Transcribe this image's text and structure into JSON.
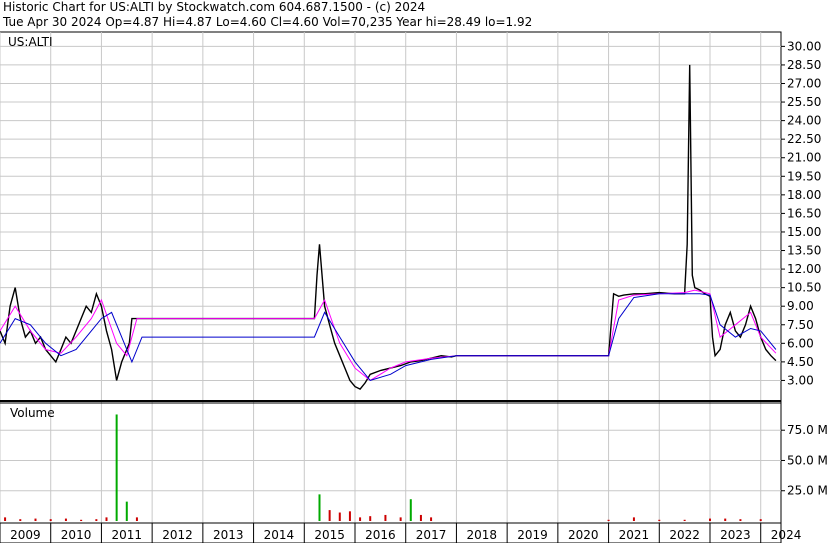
{
  "header": {
    "line1": "Historic Chart for US:ALTI by Stockwatch.com 604.687.1500 - (c) 2024",
    "line2": "Tue Apr 30 2024  Op=4.87  Hi=4.87  Lo=4.60  Cl=4.60  Vol=70,235  Year hi=28.49  lo=1.92"
  },
  "chart_data": {
    "type": "line",
    "symbol_label": "US:ALTI",
    "volume_label": "Volume",
    "price_ticks": [
      "30.00",
      "28.50",
      "27.00",
      "25.50",
      "24.00",
      "22.50",
      "21.00",
      "19.50",
      "18.00",
      "16.50",
      "15.00",
      "13.50",
      "12.00",
      "10.50",
      "9.00",
      "7.50",
      "6.00",
      "4.50",
      "3.00"
    ],
    "price_ylim": [
      1.5,
      31.0
    ],
    "volume_ticks": [
      "75.0 M",
      "50.0 M",
      "25.0 M"
    ],
    "volume_ylim": [
      0,
      95
    ],
    "x_ticks": [
      "2009",
      "2010",
      "2011",
      "2012",
      "2013",
      "2014",
      "2015",
      "2016",
      "2017",
      "2018",
      "2019",
      "2020",
      "2021",
      "2022",
      "2023",
      "2024"
    ],
    "xlim": [
      2009.0,
      2024.4
    ],
    "colors": {
      "price": "#000000",
      "ma_short": "#ff00ff",
      "ma_long": "#0000cc",
      "volume": "#cc0000",
      "volume_spike": "#00aa00",
      "grid": "#c8c8c8"
    },
    "series": [
      {
        "x": [
          2009.0,
          2009.1,
          2009.2,
          2009.3,
          2009.4,
          2009.5,
          2009.6,
          2009.7,
          2009.8,
          2009.9,
          2010.0,
          2010.1,
          2010.2,
          2010.3,
          2010.4,
          2010.5,
          2010.6,
          2010.7,
          2010.8,
          2010.9,
          2011.0,
          2011.1,
          2011.2,
          2011.3,
          2011.4,
          2011.5,
          2011.55,
          2011.6,
          2011.9,
          2015.2,
          2015.25,
          2015.3,
          2015.4,
          2015.5,
          2015.6,
          2015.7,
          2015.8,
          2015.9,
          2016.0,
          2016.1,
          2016.2,
          2016.3,
          2016.5,
          2016.7,
          2016.9,
          2017.1,
          2017.3,
          2017.5,
          2017.7,
          2017.9,
          2018.0,
          2021.0,
          2021.1,
          2021.2,
          2021.3,
          2021.5,
          2021.7,
          2022.0,
          2022.3,
          2022.5,
          2022.55,
          2022.6,
          2022.65,
          2022.7,
          2022.8,
          2022.9,
          2023.0,
          2023.05,
          2023.1,
          2023.2,
          2023.3,
          2023.4,
          2023.5,
          2023.6,
          2023.7,
          2023.8,
          2023.9,
          2024.0,
          2024.1,
          2024.2,
          2024.3
        ],
        "y": [
          7.0,
          6.0,
          9.0,
          10.5,
          8.0,
          6.5,
          7.0,
          6.0,
          6.5,
          5.5,
          5.0,
          4.5,
          5.5,
          6.5,
          6.0,
          7.0,
          8.0,
          9.0,
          8.5,
          10.0,
          9.0,
          7.0,
          5.5,
          3.0,
          4.5,
          5.5,
          6.0,
          8.0,
          8.0,
          8.0,
          11.5,
          14.0,
          9.0,
          7.5,
          6.0,
          5.0,
          4.0,
          3.0,
          2.5,
          2.3,
          2.8,
          3.5,
          3.8,
          4.0,
          4.2,
          4.5,
          4.6,
          4.8,
          5.0,
          4.9,
          5.0,
          5.0,
          10.0,
          9.8,
          9.9,
          10.0,
          10.0,
          10.1,
          10.0,
          10.0,
          14.0,
          28.5,
          11.5,
          10.5,
          10.3,
          10.0,
          9.8,
          6.5,
          5.0,
          5.5,
          7.5,
          8.5,
          7.0,
          6.5,
          7.5,
          9.0,
          8.0,
          6.5,
          5.5,
          5.0,
          4.6
        ]
      },
      {
        "name": "MA short",
        "x": [
          2009.0,
          2009.3,
          2009.6,
          2009.9,
          2010.2,
          2010.5,
          2010.8,
          2011.0,
          2011.3,
          2011.5,
          2011.7,
          2015.2,
          2015.4,
          2015.7,
          2016.0,
          2016.3,
          2016.7,
          2017.0,
          2017.5,
          2018.0,
          2021.0,
          2021.2,
          2021.5,
          2022.0,
          2022.5,
          2022.7,
          2023.0,
          2023.2,
          2023.5,
          2023.8,
          2024.0,
          2024.3
        ],
        "y": [
          7.0,
          9.0,
          7.0,
          5.5,
          5.2,
          6.5,
          8.0,
          9.5,
          6.0,
          5.0,
          8.0,
          8.0,
          9.5,
          6.0,
          4.0,
          3.0,
          4.0,
          4.5,
          4.8,
          5.0,
          5.0,
          9.5,
          9.9,
          10.0,
          10.1,
          10.3,
          10.0,
          6.5,
          7.5,
          8.5,
          6.5,
          5.2
        ]
      },
      {
        "name": "MA long",
        "x": [
          2009.0,
          2009.3,
          2009.6,
          2009.9,
          2010.2,
          2010.5,
          2010.8,
          2011.0,
          2011.2,
          2011.4,
          2011.6,
          2011.8,
          2015.2,
          2015.4,
          2015.7,
          2016.0,
          2016.3,
          2016.7,
          2017.0,
          2017.5,
          2018.0,
          2021.0,
          2021.2,
          2021.5,
          2022.0,
          2022.5,
          2022.8,
          2023.0,
          2023.2,
          2023.5,
          2023.8,
          2024.0,
          2024.3
        ],
        "y": [
          6.0,
          8.0,
          7.5,
          6.0,
          5.0,
          5.5,
          7.0,
          8.0,
          8.5,
          6.5,
          4.5,
          6.5,
          6.5,
          8.5,
          6.5,
          4.5,
          3.0,
          3.5,
          4.2,
          4.7,
          5.0,
          5.0,
          8.0,
          9.7,
          10.0,
          10.0,
          10.0,
          9.9,
          7.5,
          6.5,
          7.2,
          7.0,
          5.5
        ]
      }
    ],
    "volume_series": {
      "name": "Volume",
      "x": [
        2009.1,
        2009.4,
        2009.7,
        2010.0,
        2010.3,
        2010.6,
        2010.9,
        2011.1,
        2011.3,
        2011.5,
        2011.7,
        2015.3,
        2015.5,
        2015.7,
        2015.9,
        2016.1,
        2016.3,
        2016.6,
        2016.9,
        2017.1,
        2017.3,
        2017.5,
        2021.0,
        2021.5,
        2022.0,
        2022.5,
        2023.0,
        2023.3,
        2023.6,
        2024.0
      ],
      "y": [
        3,
        1.5,
        2,
        1.5,
        2,
        1,
        1.5,
        3,
        88,
        16,
        3,
        22,
        9,
        7,
        8,
        3,
        4,
        5,
        3,
        18,
        5,
        3,
        1,
        3,
        1,
        1,
        2,
        2,
        1.5,
        1.5
      ]
    }
  }
}
